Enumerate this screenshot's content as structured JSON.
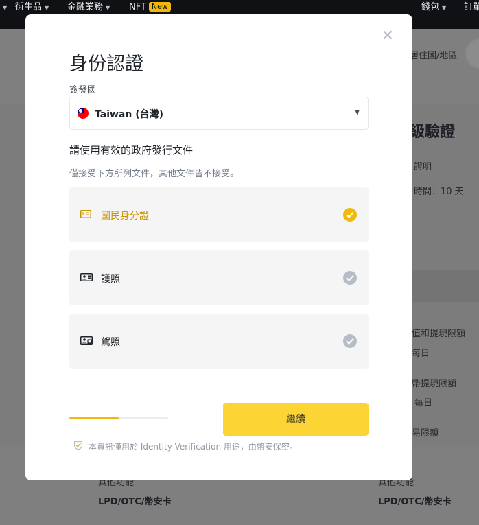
{
  "topnav": {
    "items": [
      "衍生品",
      "金融業務",
      "NFT",
      "錢包",
      "訂單"
    ],
    "new_badge": "New"
  },
  "background": {
    "residence_label": "居住國/地區",
    "verify_heading": "級驗證",
    "proof_text": "證明",
    "review_time": "時間：10 天",
    "limit_1": "值和提現限額",
    "daily_1": "每日",
    "limit_2": "幣提現限額",
    "daily_2": "每日",
    "limit_3": "易限額",
    "other_features_left": "其他功能",
    "other_features_right": "其他功能",
    "lpd_left": "LPD/OTC/幣安卡",
    "lpd_right": "LPD/OTC/幣安卡"
  },
  "modal": {
    "title": "身份認證",
    "issuing_country_label": "簽發國",
    "country": {
      "value": "Taiwan (台灣)",
      "flag_icon": "taiwan-flag-icon"
    },
    "doc_heading": "請使用有效的政府發行文件",
    "doc_note": "僅接受下方所列文件，其他文件皆不接受。",
    "documents": [
      {
        "label": "國民身分證",
        "icon": "id-card-icon",
        "selected": true
      },
      {
        "label": "護照",
        "icon": "passport-icon",
        "selected": false
      },
      {
        "label": "駕照",
        "icon": "driver-license-icon",
        "selected": false
      }
    ],
    "progress": 0.5,
    "continue_label": "繼續",
    "privacy_note": "本資訊僅用於 Identity Verification 用途，由幣安保密。"
  },
  "colors": {
    "accent": "#F0B90B",
    "button": "#FCD535",
    "selected_text": "#C99400",
    "check_inactive": "#B7BDC6"
  }
}
